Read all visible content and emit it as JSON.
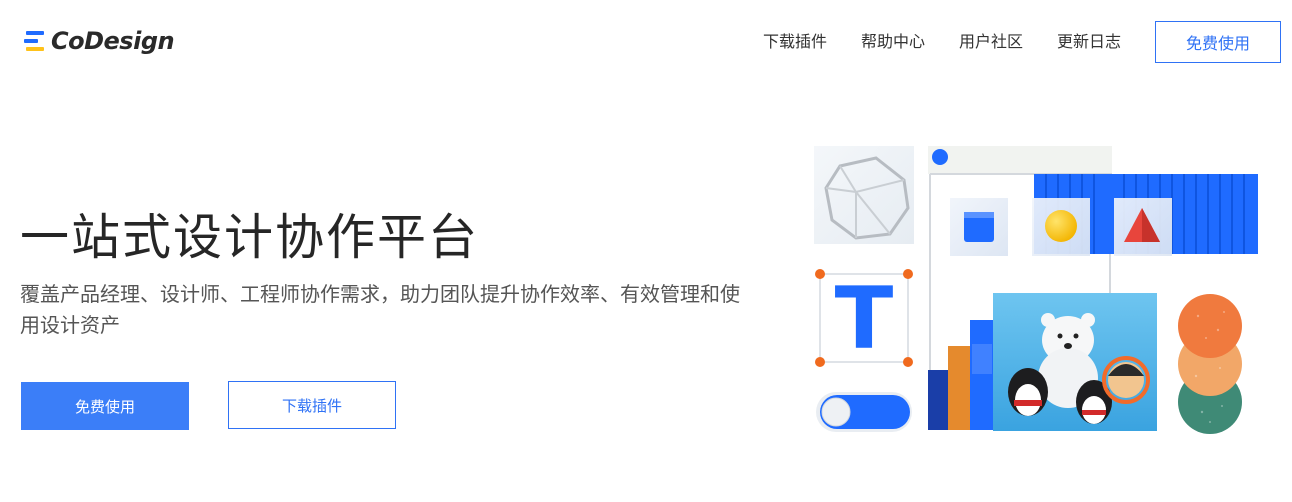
{
  "brand": {
    "name": "CoDesign"
  },
  "nav": {
    "items": [
      {
        "label": "下载插件"
      },
      {
        "label": "帮助中心"
      },
      {
        "label": "用户社区"
      },
      {
        "label": "更新日志"
      }
    ],
    "cta_label": "免费使用"
  },
  "hero": {
    "title": "一站式设计协作平台",
    "subtitle": "覆盖产品经理、设计师、工程师协作需求，助力团队提升协作效率、有效管理和使用设计资产",
    "primary_button": "免费使用",
    "secondary_button": "下载插件",
    "illustration": {
      "letter_tile": "T",
      "icons": [
        "gem-icon",
        "cube-icon",
        "sphere-icon",
        "pyramid-icon",
        "toggle-switch-icon",
        "color-swatch-icon",
        "mascot-illustration"
      ],
      "colors": {
        "primary_blue": "#1f6bff",
        "yellow": "#ffc21a",
        "red": "#e8453c",
        "orange": "#f07a3e",
        "peach": "#f2a768",
        "teal": "#3f8a76"
      }
    }
  }
}
